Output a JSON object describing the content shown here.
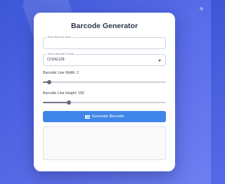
{
  "app": {
    "title": "Barcode Generator"
  },
  "form": {
    "value_field": {
      "legend": "Enter Barcode Value",
      "value": "",
      "placeholder": ""
    },
    "format_field": {
      "legend": "Select Barcode Format",
      "selected": "CODE128"
    },
    "line_width": {
      "label": "Barcode Line Width: 2",
      "value": 2,
      "min": 1,
      "max": 20
    },
    "line_height": {
      "label": "Barcode Line Height: 100",
      "value": 100,
      "min": 20,
      "max": 400
    },
    "generate_button": {
      "label": "Generate Barcode",
      "icon": "barcode-icon"
    }
  },
  "output": {
    "content": ""
  },
  "colors": {
    "accent": "#3f86e8",
    "background_start": "#3d57d8",
    "background_end": "#6f7ff2"
  }
}
